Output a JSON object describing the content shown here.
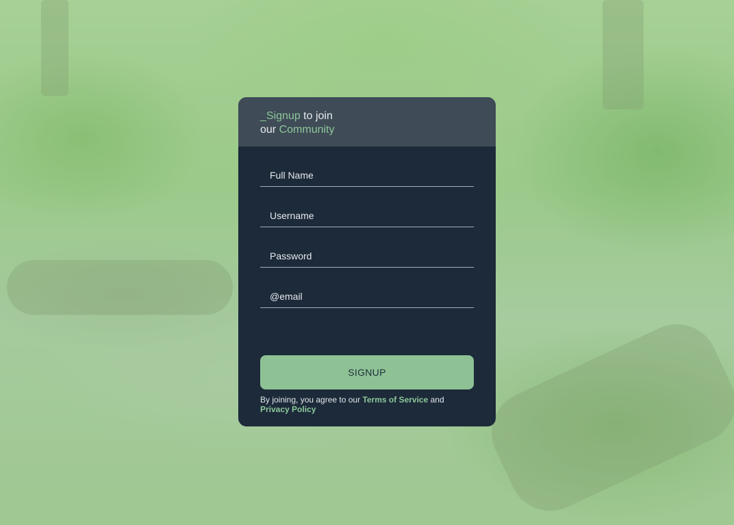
{
  "header": {
    "line1_accent": "_Signup",
    "line1_rest": " to join",
    "line2_prefix": "our ",
    "line2_accent": "Community"
  },
  "form": {
    "full_name_placeholder": "Full Name",
    "username_placeholder": "Username",
    "password_placeholder": "Password",
    "email_placeholder": "@email",
    "submit_label": "SIGNUP"
  },
  "terms": {
    "prefix": "By joining, you agree to our ",
    "terms_link": "Terms of Service",
    "middle": " and",
    "privacy_link": "Privacy Policy"
  },
  "colors": {
    "card_bg": "#1c2a3a",
    "header_bg": "#3f4b57",
    "accent": "#8ec89a",
    "button_bg": "#8ec295"
  }
}
